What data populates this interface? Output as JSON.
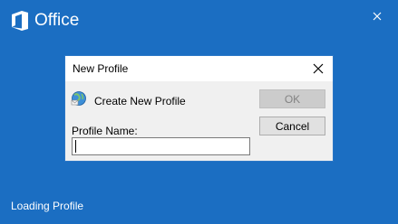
{
  "splash": {
    "brand": "Office",
    "status": "Loading Profile",
    "background_color": "#1b6ec2",
    "icons": {
      "logo": "office-logo-icon",
      "close": "close-icon"
    }
  },
  "dialog": {
    "title": "New Profile",
    "create_label": "Create New Profile",
    "ok_label": "OK",
    "ok_enabled": false,
    "cancel_label": "Cancel",
    "profile_name_label": "Profile Name:",
    "profile_name_value": "",
    "icons": {
      "create": "globe-mail-icon",
      "close": "close-icon"
    },
    "accent_color": "#2b77c6"
  }
}
